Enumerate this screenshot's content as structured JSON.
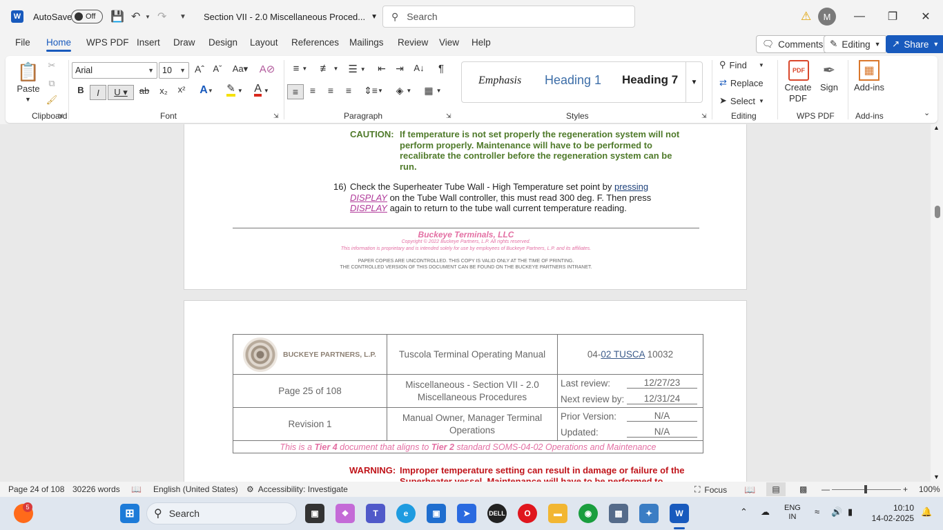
{
  "titlebar": {
    "autosave_label": "AutoSave",
    "autosave_state": "Off",
    "doc_title": "Section VII - 2.0 Miscellaneous Proced...",
    "search_placeholder": "Search",
    "avatar_initial": "M"
  },
  "menu": {
    "tabs": [
      "File",
      "Home",
      "WPS PDF",
      "Insert",
      "Draw",
      "Design",
      "Layout",
      "References",
      "Mailings",
      "Review",
      "View",
      "Help"
    ],
    "comments_label": "Comments",
    "editing_label": "Editing",
    "share_label": "Share"
  },
  "ribbon": {
    "paste_label": "Paste",
    "font_name": "Arial",
    "font_size": "10",
    "styles": [
      "Emphasis",
      "Heading 1",
      "Heading 7"
    ],
    "find_label": "Find",
    "replace_label": "Replace",
    "select_label": "Select",
    "create_pdf_label": "Create PDF",
    "sign_label": "Sign",
    "addins_label": "Add-ins",
    "groups": {
      "clipboard": "Clipboard",
      "font": "Font",
      "paragraph": "Paragraph",
      "styles": "Styles",
      "editing": "Editing",
      "wps_pdf": "WPS PDF",
      "addins": "Add-ins"
    }
  },
  "document": {
    "caution_label": "CAUTION:",
    "caution_lines": [
      "If temperature is not set properly the regeneration system will not",
      "perform properly. Maintenance will have to be performed to",
      "recalibrate the controller before the regeneration system can be",
      "run."
    ],
    "step_number": "16)",
    "step_line1": "Check the Superheater Tube Wall - High Temperature set point by",
    "step_line1_u": "pressing",
    "step_display": "DISPLAY",
    "step_line2": "on the Tube Wall controller, this must read 300 deg. F. Then press",
    "step_line3": "again to return to the tube wall current temperature reading.",
    "footer": {
      "company": "Buckeye Terminals, LLC",
      "copyright": "Copyright © 2022 Buckeye Partners, L.P. All rights reserved.",
      "proprietary": "This information is proprietary and is intended solely for use by employees of Buckeye Partners, L.P. and its affiliates.",
      "paper1": "PAPER COPIES ARE UNCONTROLLED. THIS COPY IS VALID ONLY AT THE TIME OF PRINTING.",
      "paper2": "THE CONTROLLED VERSION OF THIS DOCUMENT CAN BE FOUND ON THE BUCKEYE PARTNERS INTRANET."
    },
    "header_table": {
      "logo_text": "BUCKEYE PARTNERS, L.P.",
      "manual_title": "Tuscola Terminal Operating Manual",
      "doc_id_a": "04-",
      "doc_id_b": "02 TUSCA",
      "doc_id_c": " 10032",
      "page_of": "Page 25 of 108",
      "section_line1": "Miscellaneous - Section VII - 2.0",
      "section_line2": "Miscellaneous Procedures",
      "last_review_label": "Last review:",
      "last_review_value": "12/27/23",
      "next_review_label": "Next review by:",
      "next_review_value": "12/31/24",
      "revision": "Revision 1",
      "owner_line1": "Manual Owner, Manager Terminal",
      "owner_line2": "Operations",
      "prior_label": "Prior Version:",
      "prior_value": "N/A",
      "updated_label": "Updated:",
      "updated_value": "N/A",
      "tier_a": "This is a ",
      "tier_b": "Tier 4",
      "tier_c": " document that aligns to ",
      "tier_d": "Tier 2",
      "tier_e": " standard SOMS-04-02 Operations and Maintenance"
    },
    "warning_label": "WARNING:",
    "warning_line1": "Improper temperature setting can result in damage or failure of the",
    "warning_line2": "Superheater vessel. Maintenance will have to be performed to"
  },
  "statusbar": {
    "page": "Page 24 of 108",
    "words": "30226 words",
    "language": "English (United States)",
    "accessibility": "Accessibility: Investigate",
    "focus": "Focus",
    "zoom": "100%"
  },
  "taskbar": {
    "search_label": "Search",
    "lang_line1": "ENG",
    "lang_line2": "IN",
    "time": "10:10",
    "date": "14-02-2025",
    "badge": "5"
  },
  "colors": {
    "accent": "#185abd",
    "caution": "#4f7a2a",
    "warning": "#c0141a",
    "footer_pink": "#e0609a",
    "display_word": "#b03a9a"
  }
}
